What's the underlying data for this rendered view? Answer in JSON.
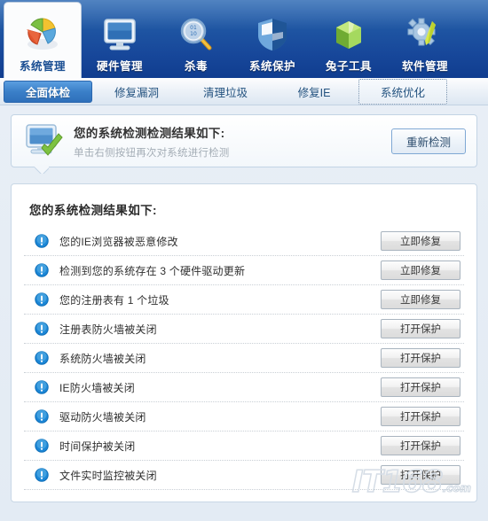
{
  "colors": {
    "toolbar_blue_top": "#2f6bb5",
    "toolbar_blue_bottom": "#103d8f",
    "active_tab_blue": "#3a7fc8",
    "page_bg": "#e9eff6",
    "card_bg": "#ffffff",
    "alert_icon_blue": "#1b86d6",
    "subtitle_gray": "#a4adb6"
  },
  "toolbar": {
    "items": [
      {
        "label": "系统管理",
        "icon": "pie-chart-icon",
        "active": true
      },
      {
        "label": "硬件管理",
        "icon": "monitor-icon",
        "active": false
      },
      {
        "label": "杀毒",
        "icon": "magnifier-virus-icon",
        "active": false
      },
      {
        "label": "系统保护",
        "icon": "shield-icon",
        "active": false
      },
      {
        "label": "兔子工具",
        "icon": "green-box-icon",
        "active": false
      },
      {
        "label": "软件管理",
        "icon": "gear-wrench-icon",
        "active": false
      }
    ]
  },
  "tabs": [
    {
      "label": "全面体检",
      "state": "active"
    },
    {
      "label": "修复漏洞",
      "state": "normal"
    },
    {
      "label": "清理垃圾",
      "state": "normal"
    },
    {
      "label": "修复IE",
      "state": "normal"
    },
    {
      "label": "系统优化",
      "state": "focused"
    }
  ],
  "status_panel": {
    "icon": "monitor-check-icon",
    "title": "您的系统检测检测结果如下:",
    "subtitle": "单击右侧按钮再次对系统进行检测",
    "rescan_button": "重新检测"
  },
  "results": {
    "heading": "您的系统检测结果如下:",
    "rows": [
      {
        "icon": "alert-circle-icon",
        "label": "您的IE浏览器被恶意修改",
        "action": "立即修复"
      },
      {
        "icon": "alert-circle-icon",
        "label": "检测到您的系统存在 3 个硬件驱动更新",
        "action": "立即修复"
      },
      {
        "icon": "alert-circle-icon",
        "label": "您的注册表有 1 个垃圾",
        "action": "立即修复"
      },
      {
        "icon": "alert-circle-icon",
        "label": "注册表防火墙被关闭",
        "action": "打开保护"
      },
      {
        "icon": "alert-circle-icon",
        "label": "系统防火墙被关闭",
        "action": "打开保护"
      },
      {
        "icon": "alert-circle-icon",
        "label": "IE防火墙被关闭",
        "action": "打开保护"
      },
      {
        "icon": "alert-circle-icon",
        "label": "驱动防火墙被关闭",
        "action": "打开保护"
      },
      {
        "icon": "alert-circle-icon",
        "label": "时间保护被关闭",
        "action": "打开保护"
      },
      {
        "icon": "alert-circle-icon",
        "label": "文件实时监控被关闭",
        "action": "打开保护"
      }
    ]
  },
  "watermark": {
    "text": "IT168",
    "suffix": ".com"
  }
}
